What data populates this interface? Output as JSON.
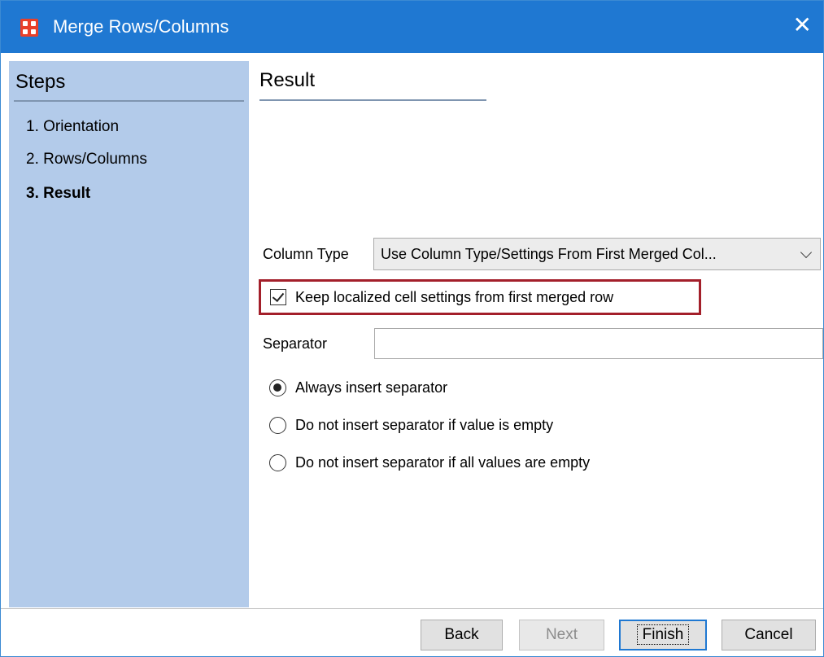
{
  "window": {
    "title": "Merge Rows/Columns",
    "close_glyph": "✕",
    "app_icon": "app-grid-icon"
  },
  "sidebar": {
    "heading": "Steps",
    "steps": [
      {
        "label": "1. Orientation",
        "active": false
      },
      {
        "label": "2. Rows/Columns",
        "active": false
      },
      {
        "label": "3. Result",
        "active": true
      }
    ]
  },
  "main": {
    "heading": "Result",
    "column_type": {
      "label": "Column Type",
      "value": "Use Column Type/Settings From First Merged Col..."
    },
    "keep_localized": {
      "label": "Keep localized cell settings from first merged row",
      "checked": true
    },
    "separator": {
      "label": "Separator",
      "value": ""
    },
    "options": [
      {
        "label": "Always insert separator",
        "selected": true
      },
      {
        "label": "Do not insert separator if value is empty",
        "selected": false
      },
      {
        "label": "Do not insert separator if all values are empty",
        "selected": false
      }
    ]
  },
  "footer": {
    "back": "Back",
    "next": "Next",
    "finish": "Finish",
    "cancel": "Cancel"
  },
  "colors": {
    "titlebar": "#1f78d2",
    "sidebar": "#b3cbea",
    "highlight": "#a31f2a"
  }
}
